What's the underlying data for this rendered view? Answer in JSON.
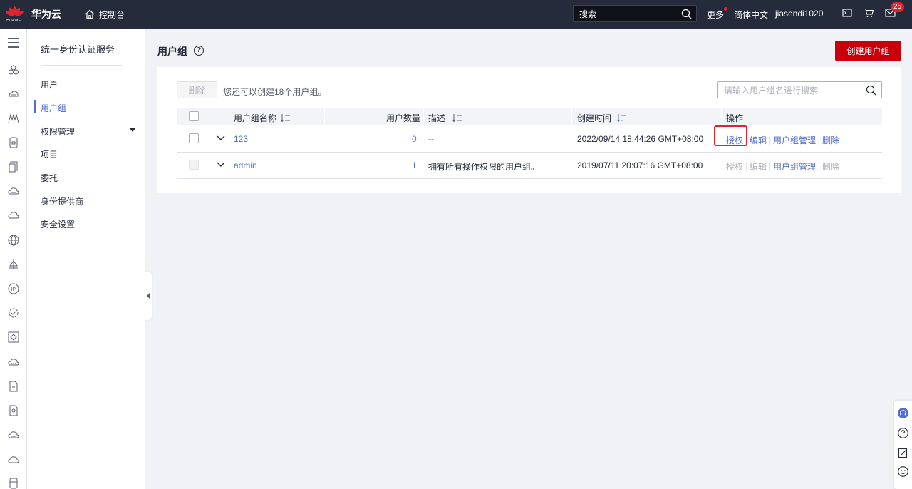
{
  "header": {
    "logo_text": "HUAWEI",
    "brand": "华为云",
    "console_label": "控制台",
    "search_placeholder": "搜索",
    "more_label": "更多",
    "language_label": "简体中文",
    "username": "jiasendi1020",
    "message_count": "25"
  },
  "sidebar": {
    "title": "统一身份认证服务",
    "items": [
      {
        "label": "用户"
      },
      {
        "label": "用户组",
        "active": true
      },
      {
        "label": "权限管理"
      },
      {
        "label": "项目"
      },
      {
        "label": "委托"
      },
      {
        "label": "身份提供商"
      },
      {
        "label": "安全设置"
      }
    ]
  },
  "page": {
    "title": "用户组",
    "help_glyph": "?",
    "create_button": "创建用户组",
    "delete_button": "删除",
    "quota_text": "您还可以创建18个用户组。",
    "search_placeholder": "请输入用户组名进行搜索"
  },
  "table": {
    "columns": [
      "用户组名称",
      "用户数量",
      "描述",
      "创建时间",
      "操作"
    ],
    "rows": [
      {
        "name": "123",
        "user_count": "0",
        "description": "--",
        "created": "2022/09/14 18:44:26 GMT+08:00",
        "actions": [
          "授权",
          "编辑",
          "用户组管理",
          "删除"
        ],
        "actions_enabled": [
          true,
          true,
          true,
          true
        ]
      },
      {
        "name": "admin",
        "user_count": "1",
        "description": "拥有所有操作权限的用户组。",
        "created": "2019/07/11 20:07:16 GMT+08:00",
        "actions": [
          "授权",
          "编辑",
          "用户组管理",
          "删除"
        ],
        "actions_enabled": [
          false,
          false,
          true,
          false
        ]
      }
    ]
  },
  "colors": {
    "accent": "#526ecc",
    "brand_red": "#c7000b",
    "topbar": "#252b3a"
  }
}
